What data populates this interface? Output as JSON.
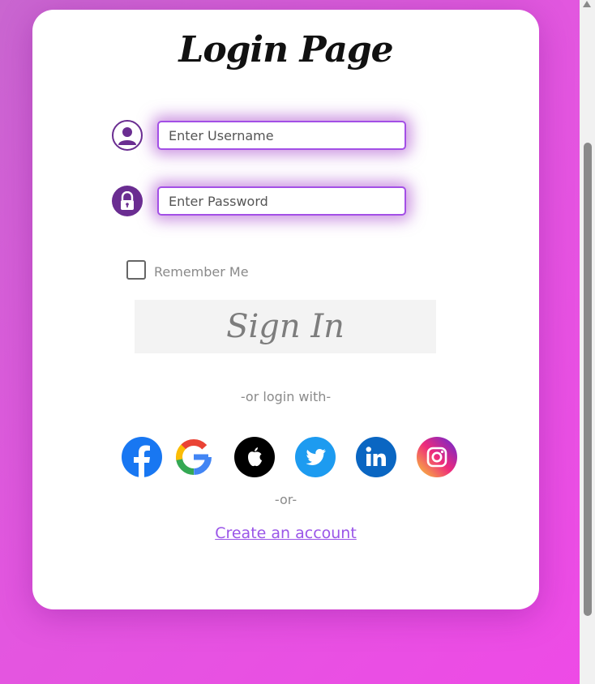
{
  "title": "Login Page",
  "username": {
    "placeholder": "Enter Username"
  },
  "password": {
    "placeholder": "Enter Password"
  },
  "remember_me": {
    "label": "Remember Me",
    "checked": false
  },
  "signin_button": {
    "label": "Sign In"
  },
  "alt_login_text": "-or login with-",
  "social_providers": [
    {
      "name": "facebook-icon",
      "color": "#1877f2"
    },
    {
      "name": "google-icon",
      "color": "#4285f4"
    },
    {
      "name": "apple-icon",
      "color": "#000000"
    },
    {
      "name": "twitter-icon",
      "color": "#1d9bf0"
    },
    {
      "name": "linkedin-icon",
      "color": "#0a66c2"
    },
    {
      "name": "instagram-icon",
      "color": "#d6249f"
    }
  ],
  "separator_text": "-or-",
  "create_account_link": "Create an account",
  "colors": {
    "accent": "#a34fe6",
    "icon": "#6a2d91",
    "link": "#9a55e8",
    "background_start": "#c966d0",
    "background_end": "#ee4ae6"
  }
}
